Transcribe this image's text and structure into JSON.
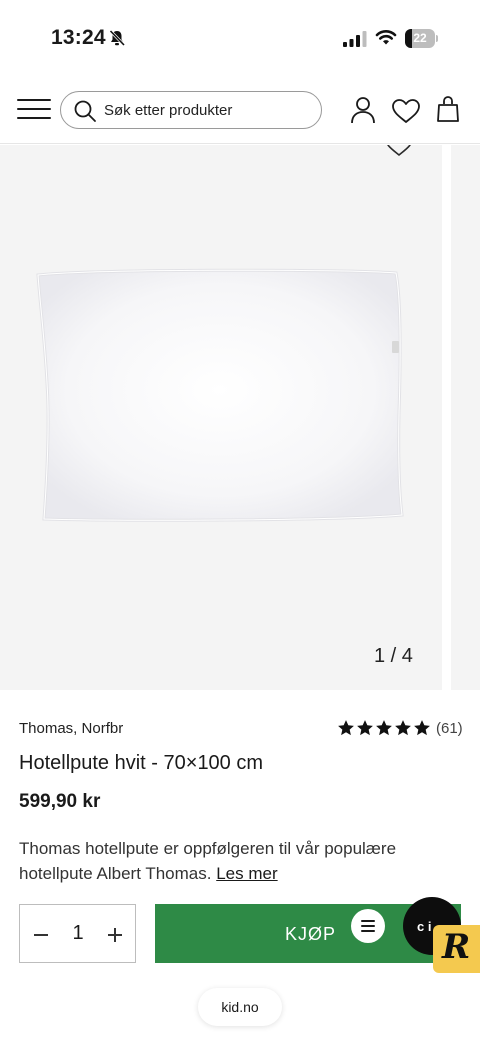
{
  "status_bar": {
    "time": "13:24",
    "battery": 22,
    "battery_label": "22",
    "icons": [
      "bell-slash-icon",
      "signal-icon",
      "wifi-icon",
      "battery-icon"
    ]
  },
  "header": {
    "search_placeholder": "Søk etter produkter",
    "icons": [
      "menu-icon",
      "search-icon",
      "user-icon",
      "heart-icon",
      "bag-icon"
    ]
  },
  "gallery": {
    "counter": "1 / 4",
    "current": 1,
    "total": 4
  },
  "product": {
    "brand": "Thomas, Norfbr",
    "rating": 5,
    "rating_count": "(61)",
    "title": "Hotellpute hvit - 70×100 cm",
    "price": "599,90 kr",
    "description": "Thomas hotellpute er oppfølgeren til vår populære hotellpute Albert Thomas.",
    "read_more": "Les mer"
  },
  "purchase": {
    "quantity": "1",
    "buy_label": "KJØP",
    "buy_color": "#2e8a46"
  },
  "widgets": {
    "chat_text": "c  i",
    "badge_letter": "R",
    "badge_color": "#f4c94f"
  },
  "browser": {
    "url": "kid.no"
  }
}
